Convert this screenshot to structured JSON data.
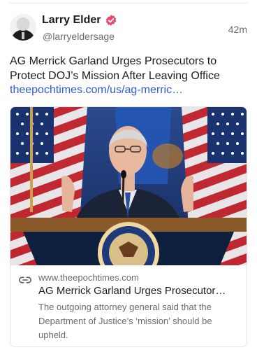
{
  "post": {
    "author_name": "Larry Elder",
    "handle": "@larryeldersage",
    "time": "42m",
    "text_line1": "AG Merrick Garland Urges Prosecutors to",
    "text_line2": "Protect DOJ’s Mission After Leaving Office",
    "link_text": "theepochtimes.com/us/ag-merric…"
  },
  "link_card": {
    "site": "www.theepochtimes.com",
    "title": "AG Merrick Garland Urges Prosecutor…",
    "desc_line1": "The outgoing attorney general said that the",
    "desc_line2": "Department of Justice’s ‘mission’ should be",
    "desc_line3": "upheld."
  },
  "colors": {
    "link": "#2e5bd8",
    "verified_badge": "#e04e6e",
    "muted_text": "#6b6b6b"
  },
  "icons": {
    "verified": "verified-badge-icon",
    "link": "link-chain-icon"
  }
}
